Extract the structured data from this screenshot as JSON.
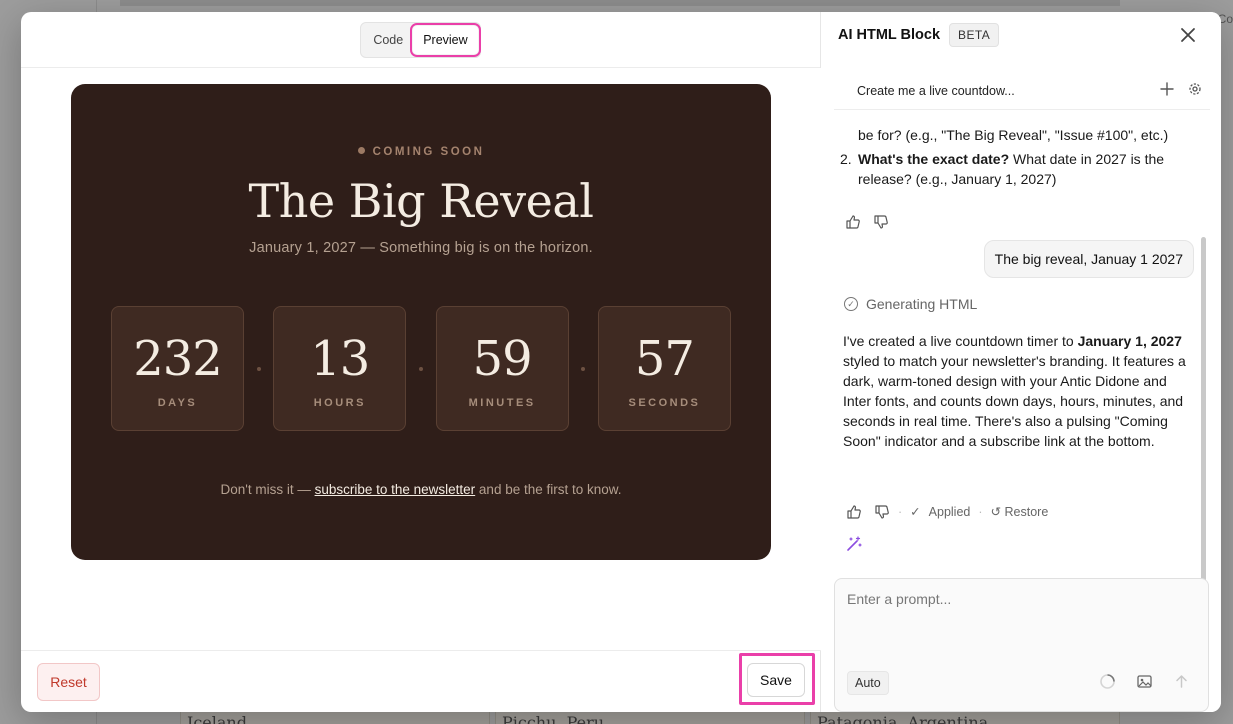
{
  "background": {
    "card_texts": [
      "Iceland",
      "Picchu, Peru",
      "Patagonia, Argentina"
    ],
    "side_text": "Co"
  },
  "toolbar": {
    "code_tab": "Code",
    "preview_tab": "Preview"
  },
  "countdown": {
    "eyebrow": "COMING SOON",
    "title": "The Big Reveal",
    "subtitle": "January 1, 2027 — Something big is on the horizon.",
    "units": [
      {
        "value": "232",
        "label": "DAYS"
      },
      {
        "value": "13",
        "label": "HOURS"
      },
      {
        "value": "59",
        "label": "MINUTES"
      },
      {
        "value": "57",
        "label": "SECONDS"
      }
    ],
    "footer_before": "Don't miss it — ",
    "footer_link": "subscribe to the newsletter",
    "footer_after": " and be the first to know."
  },
  "footer": {
    "reset_label": "Reset",
    "save_label": "Save"
  },
  "panel": {
    "title": "AI HTML Block",
    "badge": "BETA",
    "conversation_title": "Create me a live countdow...",
    "assistant_prev": {
      "line1_cont": "be for? (e.g., \"The Big Reveal\", \"Issue #100\", etc.)",
      "item2_num": "2.",
      "item2_bold": "What's the exact date?",
      "item2_rest": " What date in 2027 is the",
      "item2_line2": "release? (e.g., January 1, 2027)"
    },
    "user_message": "The big reveal, Januay 1 2027",
    "generating_label": "Generating HTML",
    "reply": {
      "p1": "I've created a live countdown timer to ",
      "bold": "January 1, 2027",
      "p2": " styled to match your newsletter's branding. It features a dark, warm-toned design with your Antic Didone and Inter fonts, and counts down days, hours, minutes, and seconds in real time. There's also a pulsing \"Coming Soon\" indicator and a subscribe link at the bottom."
    },
    "applied_label": "Applied",
    "restore_label": "Restore",
    "prompt_placeholder": "Enter a prompt...",
    "mode_label": "Auto"
  },
  "colors": {
    "card_bg": "#2f1e19",
    "unit_bg": "#3f2a22",
    "highlight": "#ea3fa9",
    "reset_text": "#c0392b",
    "magic": "#8b4de0"
  }
}
